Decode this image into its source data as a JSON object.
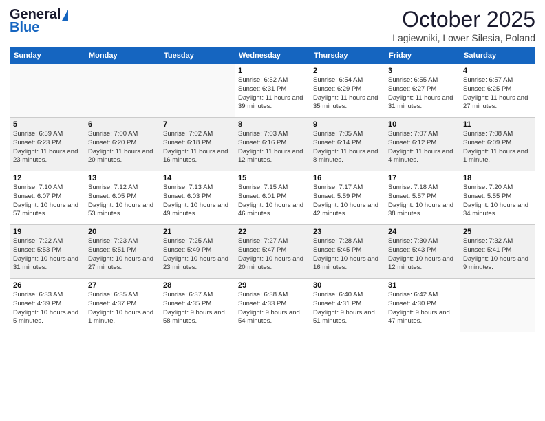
{
  "logo": {
    "general": "General",
    "blue": "Blue"
  },
  "header": {
    "month": "October 2025",
    "location": "Lagiewniki, Lower Silesia, Poland"
  },
  "weekdays": [
    "Sunday",
    "Monday",
    "Tuesday",
    "Wednesday",
    "Thursday",
    "Friday",
    "Saturday"
  ],
  "weeks": [
    [
      {
        "day": "",
        "info": ""
      },
      {
        "day": "",
        "info": ""
      },
      {
        "day": "",
        "info": ""
      },
      {
        "day": "1",
        "info": "Sunrise: 6:52 AM\nSunset: 6:31 PM\nDaylight: 11 hours\nand 39 minutes."
      },
      {
        "day": "2",
        "info": "Sunrise: 6:54 AM\nSunset: 6:29 PM\nDaylight: 11 hours\nand 35 minutes."
      },
      {
        "day": "3",
        "info": "Sunrise: 6:55 AM\nSunset: 6:27 PM\nDaylight: 11 hours\nand 31 minutes."
      },
      {
        "day": "4",
        "info": "Sunrise: 6:57 AM\nSunset: 6:25 PM\nDaylight: 11 hours\nand 27 minutes."
      }
    ],
    [
      {
        "day": "5",
        "info": "Sunrise: 6:59 AM\nSunset: 6:23 PM\nDaylight: 11 hours\nand 23 minutes."
      },
      {
        "day": "6",
        "info": "Sunrise: 7:00 AM\nSunset: 6:20 PM\nDaylight: 11 hours\nand 20 minutes."
      },
      {
        "day": "7",
        "info": "Sunrise: 7:02 AM\nSunset: 6:18 PM\nDaylight: 11 hours\nand 16 minutes."
      },
      {
        "day": "8",
        "info": "Sunrise: 7:03 AM\nSunset: 6:16 PM\nDaylight: 11 hours\nand 12 minutes."
      },
      {
        "day": "9",
        "info": "Sunrise: 7:05 AM\nSunset: 6:14 PM\nDaylight: 11 hours\nand 8 minutes."
      },
      {
        "day": "10",
        "info": "Sunrise: 7:07 AM\nSunset: 6:12 PM\nDaylight: 11 hours\nand 4 minutes."
      },
      {
        "day": "11",
        "info": "Sunrise: 7:08 AM\nSunset: 6:09 PM\nDaylight: 11 hours\nand 1 minute."
      }
    ],
    [
      {
        "day": "12",
        "info": "Sunrise: 7:10 AM\nSunset: 6:07 PM\nDaylight: 10 hours\nand 57 minutes."
      },
      {
        "day": "13",
        "info": "Sunrise: 7:12 AM\nSunset: 6:05 PM\nDaylight: 10 hours\nand 53 minutes."
      },
      {
        "day": "14",
        "info": "Sunrise: 7:13 AM\nSunset: 6:03 PM\nDaylight: 10 hours\nand 49 minutes."
      },
      {
        "day": "15",
        "info": "Sunrise: 7:15 AM\nSunset: 6:01 PM\nDaylight: 10 hours\nand 46 minutes."
      },
      {
        "day": "16",
        "info": "Sunrise: 7:17 AM\nSunset: 5:59 PM\nDaylight: 10 hours\nand 42 minutes."
      },
      {
        "day": "17",
        "info": "Sunrise: 7:18 AM\nSunset: 5:57 PM\nDaylight: 10 hours\nand 38 minutes."
      },
      {
        "day": "18",
        "info": "Sunrise: 7:20 AM\nSunset: 5:55 PM\nDaylight: 10 hours\nand 34 minutes."
      }
    ],
    [
      {
        "day": "19",
        "info": "Sunrise: 7:22 AM\nSunset: 5:53 PM\nDaylight: 10 hours\nand 31 minutes."
      },
      {
        "day": "20",
        "info": "Sunrise: 7:23 AM\nSunset: 5:51 PM\nDaylight: 10 hours\nand 27 minutes."
      },
      {
        "day": "21",
        "info": "Sunrise: 7:25 AM\nSunset: 5:49 PM\nDaylight: 10 hours\nand 23 minutes."
      },
      {
        "day": "22",
        "info": "Sunrise: 7:27 AM\nSunset: 5:47 PM\nDaylight: 10 hours\nand 20 minutes."
      },
      {
        "day": "23",
        "info": "Sunrise: 7:28 AM\nSunset: 5:45 PM\nDaylight: 10 hours\nand 16 minutes."
      },
      {
        "day": "24",
        "info": "Sunrise: 7:30 AM\nSunset: 5:43 PM\nDaylight: 10 hours\nand 12 minutes."
      },
      {
        "day": "25",
        "info": "Sunrise: 7:32 AM\nSunset: 5:41 PM\nDaylight: 10 hours\nand 9 minutes."
      }
    ],
    [
      {
        "day": "26",
        "info": "Sunrise: 6:33 AM\nSunset: 4:39 PM\nDaylight: 10 hours\nand 5 minutes."
      },
      {
        "day": "27",
        "info": "Sunrise: 6:35 AM\nSunset: 4:37 PM\nDaylight: 10 hours\nand 1 minute."
      },
      {
        "day": "28",
        "info": "Sunrise: 6:37 AM\nSunset: 4:35 PM\nDaylight: 9 hours\nand 58 minutes."
      },
      {
        "day": "29",
        "info": "Sunrise: 6:38 AM\nSunset: 4:33 PM\nDaylight: 9 hours\nand 54 minutes."
      },
      {
        "day": "30",
        "info": "Sunrise: 6:40 AM\nSunset: 4:31 PM\nDaylight: 9 hours\nand 51 minutes."
      },
      {
        "day": "31",
        "info": "Sunrise: 6:42 AM\nSunset: 4:30 PM\nDaylight: 9 hours\nand 47 minutes."
      },
      {
        "day": "",
        "info": ""
      }
    ]
  ]
}
